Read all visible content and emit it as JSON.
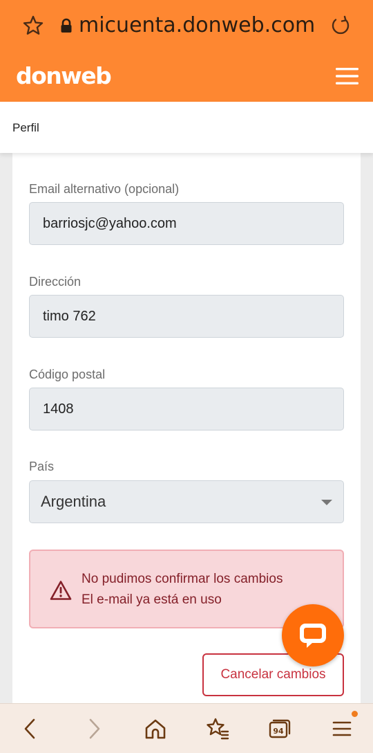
{
  "browser": {
    "url": "micuenta.donweb.com",
    "tab_count": "94"
  },
  "site": {
    "logo": "donweb"
  },
  "breadcrumb": {
    "current": "Perfil"
  },
  "form": {
    "alt_email": {
      "label": "Email alternativo (opcional)",
      "value": "barriosjc@yahoo.com"
    },
    "address": {
      "label": "Dirección",
      "value": "timo 762"
    },
    "postal_code": {
      "label": "Código postal",
      "value": "1408"
    },
    "country": {
      "label": "País",
      "value": "Argentina"
    }
  },
  "alert": {
    "title": "No pudimos confirmar los cambios",
    "message": "El e-mail ya está en uso"
  },
  "actions": {
    "cancel_label": "Cancelar cambios"
  },
  "colors": {
    "brand": "#fe8731",
    "alert_bg": "#f8d7da",
    "alert_text": "#842029",
    "danger": "#c8323f"
  },
  "icons": [
    "star-icon",
    "lock-icon",
    "reload-icon",
    "hamburger-menu-icon",
    "warning-icon",
    "chat-icon",
    "back-icon",
    "forward-icon",
    "home-icon",
    "bookmarks-icon",
    "tabs-icon",
    "browser-menu-icon"
  ]
}
